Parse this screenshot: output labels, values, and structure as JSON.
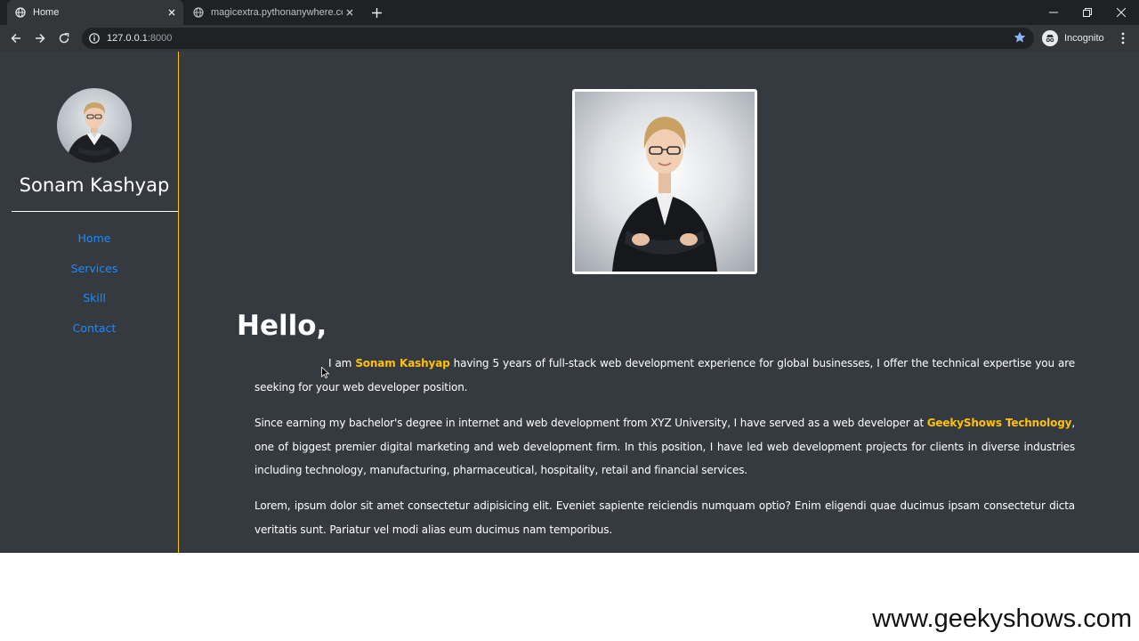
{
  "browser": {
    "tabs": [
      {
        "title": "Home",
        "active": true
      },
      {
        "title": "magicextra.pythonanywhere.com",
        "active": false
      }
    ],
    "url": {
      "host": "127.0.0.1",
      "port": ":8000"
    },
    "profile_label": "Incognito"
  },
  "sidebar": {
    "name": "Sonam Kashyap",
    "nav": [
      {
        "label": "Home"
      },
      {
        "label": "Services"
      },
      {
        "label": "Skill"
      },
      {
        "label": "Contact"
      }
    ]
  },
  "main": {
    "greeting": "Hello,",
    "intro": {
      "before": "I am ",
      "name": "Sonam Kashyap",
      "after": " having 5 years of full-stack web development experience for global businesses, I offer the technical expertise you are seeking for your web developer position."
    },
    "career": {
      "before": "Since earning my bachelor's degree in internet and web development from XYZ University, I have served as a web developer at ",
      "company": "GeekyShows Technology",
      "after": ", one of biggest premier digital marketing and web development firm. In this position, I have led web development projects for clients in diverse industries including technology, manufacturing, pharmaceutical, hospitality, retail and financial services."
    },
    "lorem": "Lorem, ipsum dolor sit amet consectetur adipisicing elit. Eveniet sapiente reiciendis numquam optio? Enim eligendi quae ducimus ipsam consectetur dicta veritatis sunt. Pariatur vel modi alias eum ducimus nam temporibus."
  },
  "watermark": "www.geekyshows.com",
  "colors": {
    "accent": "#ffc107",
    "link": "#1e8bff",
    "page_bg": "#343a40"
  }
}
